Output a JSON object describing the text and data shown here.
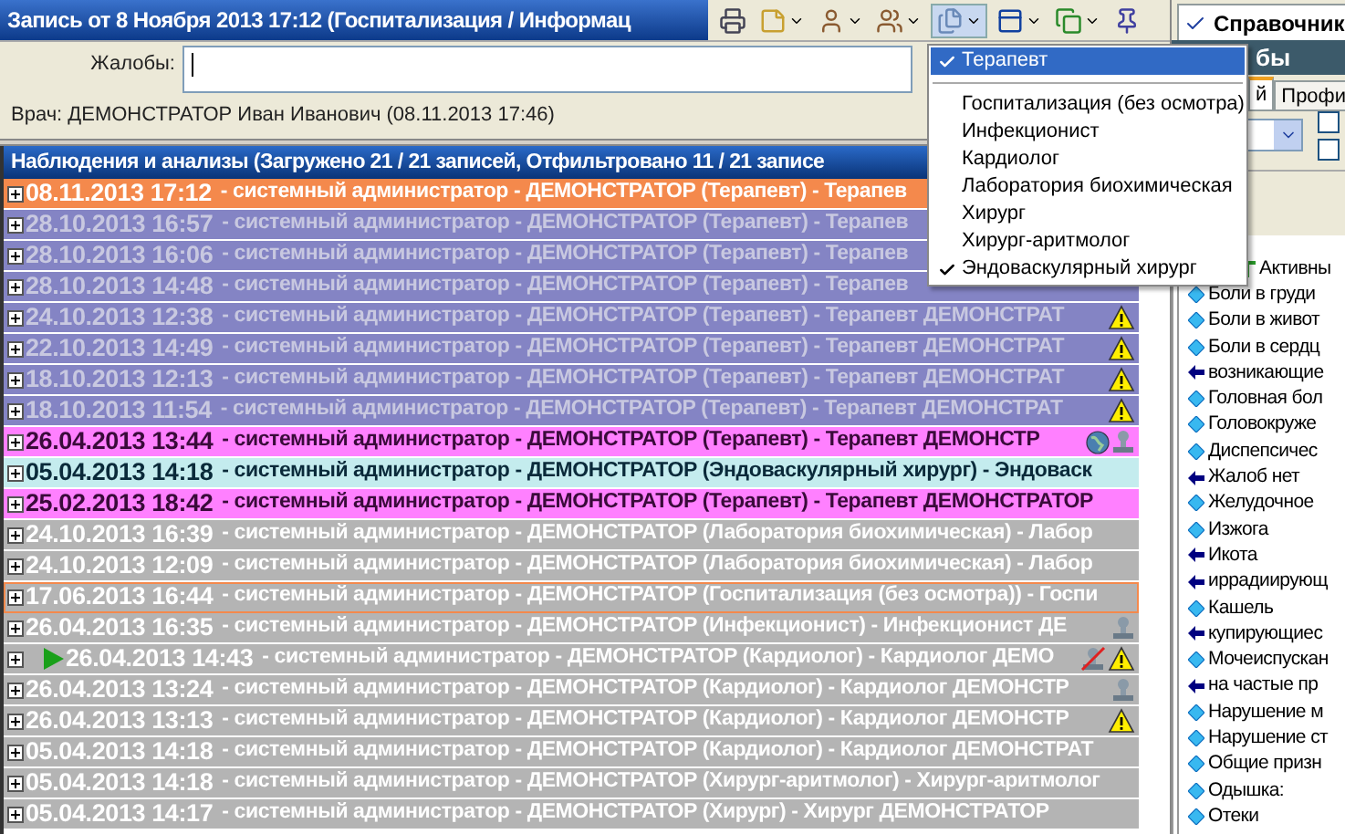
{
  "window": {
    "title": "Запись от 8 Ноября 2013 17:12 (Госпитализация / Информац"
  },
  "complaints": {
    "label": "Жалобы:"
  },
  "doctor_line": "Врач: ДЕМОНСТРАТОР Иван Иванович (08.11.2013 17:46)",
  "list": {
    "title": "Наблюдения и анализы (Загружено 21 / 21 записей, Отфильтровано 11 / 21 записе",
    "rows": [
      {
        "date": "08.11.2013 17:12",
        "text": "- системный администратор - ДЕМОНСТРАТОР (Терапевт) - Терапев",
        "kind": "orange",
        "selected": false,
        "current": false,
        "icons": []
      },
      {
        "date": "28.10.2013 16:57",
        "text": "- системный администратор - ДЕМОНСТРАТОР (Терапевт) - Терапев",
        "kind": "purple",
        "selected": false,
        "current": false,
        "icons": []
      },
      {
        "date": "28.10.2013 16:06",
        "text": "- системный администратор - ДЕМОНСТРАТОР (Терапевт) - Терапев",
        "kind": "purple",
        "selected": false,
        "current": false,
        "icons": []
      },
      {
        "date": "28.10.2013 14:48",
        "text": "- системный администратор - ДЕМОНСТРАТОР (Терапевт) - Терапев",
        "kind": "purple",
        "selected": false,
        "current": false,
        "icons": []
      },
      {
        "date": "24.10.2013 12:38",
        "text": "- системный администратор - ДЕМОНСТРАТОР (Терапевт) - Терапевт ДЕМОНСТРАТ",
        "kind": "purple",
        "selected": false,
        "current": false,
        "icons": [
          {
            "kind": "warning"
          }
        ]
      },
      {
        "date": "22.10.2013 14:49",
        "text": "- системный администратор - ДЕМОНСТРАТОР (Терапевт) - Терапевт ДЕМОНСТРАТ",
        "kind": "purple",
        "selected": false,
        "current": false,
        "icons": [
          {
            "kind": "warning"
          }
        ]
      },
      {
        "date": "18.10.2013 12:13",
        "text": "- системный администратор - ДЕМОНСТРАТОР (Терапевт) - Терапевт ДЕМОНСТРАТ",
        "kind": "purple",
        "selected": false,
        "current": false,
        "icons": [
          {
            "kind": "warning"
          }
        ]
      },
      {
        "date": "18.10.2013 11:54",
        "text": "- системный администратор - ДЕМОНСТРАТОР (Терапевт) - Терапевт ДЕМОНСТРАТ",
        "kind": "purple",
        "selected": false,
        "current": false,
        "icons": [
          {
            "kind": "warning"
          }
        ]
      },
      {
        "date": "26.04.2013 13:44",
        "text": "- системный администратор - ДЕМОНСТРАТОР (Терапевт) - Терапевт ДЕМОНСТР",
        "kind": "magenta",
        "selected": false,
        "current": false,
        "icons": [
          {
            "kind": "globe"
          },
          {
            "kind": "stamp"
          }
        ]
      },
      {
        "date": "05.04.2013 14:18",
        "text": "- системный администратор - ДЕМОНСТРАТОР (Эндоваскулярный хирург) - Эндоваск",
        "kind": "cyan",
        "selected": false,
        "current": false,
        "icons": []
      },
      {
        "date": "25.02.2013 18:42",
        "text": "- системный администратор - ДЕМОНСТРАТОР (Терапевт) - Терапевт ДЕМОНСТРАТОР",
        "kind": "magenta",
        "selected": false,
        "current": false,
        "icons": []
      },
      {
        "date": "24.10.2013 16:39",
        "text": "- системный администратор - ДЕМОНСТРАТОР (Лаборатория биохимическая) - Лабор",
        "kind": "grey",
        "selected": false,
        "current": false,
        "icons": []
      },
      {
        "date": "24.10.2013 12:09",
        "text": "- системный администратор - ДЕМОНСТРАТОР (Лаборатория биохимическая) - Лабор",
        "kind": "grey",
        "selected": false,
        "current": false,
        "icons": []
      },
      {
        "date": "17.06.2013 16:44",
        "text": "- системный администратор - ДЕМОНСТРАТОР (Госпитализация (без осмотра)) - Госпи",
        "kind": "grey",
        "selected": true,
        "current": false,
        "icons": []
      },
      {
        "date": "26.04.2013 16:35",
        "text": "- системный администратор - ДЕМОНСТРАТОР (Инфекционист) - Инфекционист ДЕ",
        "kind": "grey",
        "selected": false,
        "current": false,
        "icons": [
          {
            "kind": "stamp"
          }
        ]
      },
      {
        "date": "26.04.2013 14:43",
        "text": "- системный администратор - ДЕМОНСТРАТОР (Кардиолог) - Кардиолог ДЕМО",
        "kind": "grey",
        "selected": false,
        "current": true,
        "icons": [
          {
            "kind": "stamp-crossed"
          },
          {
            "kind": "warning"
          }
        ]
      },
      {
        "date": "26.04.2013 13:24",
        "text": "- системный администратор - ДЕМОНСТРАТОР (Кардиолог) - Кардиолог ДЕМОНСТР",
        "kind": "grey",
        "selected": false,
        "current": false,
        "icons": [
          {
            "kind": "stamp"
          }
        ]
      },
      {
        "date": "26.04.2013 13:13",
        "text": "- системный администратор - ДЕМОНСТРАТОР (Кардиолог) - Кардиолог ДЕМОНСТР",
        "kind": "grey",
        "selected": false,
        "current": false,
        "icons": [
          {
            "kind": "warning"
          }
        ]
      },
      {
        "date": "05.04.2013 14:18",
        "text": "- системный администратор - ДЕМОНСТРАТОР (Кардиолог) - Кардиолог ДЕМОНСТРАТ",
        "kind": "grey",
        "selected": false,
        "current": false,
        "icons": []
      },
      {
        "date": "05.04.2013 14:18",
        "text": "- системный администратор - ДЕМОНСТРАТОР (Хирург-аритмолог) - Хирург-аритмолог",
        "kind": "grey",
        "selected": false,
        "current": false,
        "icons": []
      },
      {
        "date": "05.04.2013 14:17",
        "text": "- системный администратор - ДЕМОНСТРАТОР (Хирург) - Хирург ДЕМОНСТРАТОР",
        "kind": "grey",
        "selected": false,
        "current": false,
        "icons": []
      }
    ]
  },
  "menu": {
    "items": [
      {
        "label": "Терапевт",
        "checked": true,
        "selected": true,
        "separator_after": true
      },
      {
        "label": "Госпитализация (без осмотра)",
        "checked": false,
        "selected": false,
        "separator_after": false
      },
      {
        "label": "Инфекционист",
        "checked": false,
        "selected": false,
        "separator_after": false
      },
      {
        "label": "Кардиолог",
        "checked": false,
        "selected": false,
        "separator_after": false
      },
      {
        "label": "Лаборатория биохимическая",
        "checked": false,
        "selected": false,
        "separator_after": false
      },
      {
        "label": "Хирург",
        "checked": false,
        "selected": false,
        "separator_after": false
      },
      {
        "label": "Хирург-аритмолог",
        "checked": false,
        "selected": false,
        "separator_after": false
      },
      {
        "label": "Эндоваскулярный хирург",
        "checked": true,
        "selected": false,
        "separator_after": false
      }
    ]
  },
  "side": {
    "tab": "Справочник",
    "header": "бы",
    "checkboxes": [
      {
        "checked": false
      },
      {
        "checked": false
      }
    ],
    "tabs": [
      {
        "label": "й",
        "selected": true
      },
      {
        "label": "Профи",
        "selected": false
      }
    ],
    "tree": [
      {
        "label": "Активны",
        "kind": "root"
      },
      {
        "label": "Боли в груди",
        "kind": "diamond"
      },
      {
        "label": "Боли в живот",
        "kind": "diamond"
      },
      {
        "label": "Боли в сердц",
        "kind": "diamond"
      },
      {
        "label": "возникающие",
        "kind": "arrow"
      },
      {
        "label": "Головная бол",
        "kind": "diamond"
      },
      {
        "label": "Головокруже",
        "kind": "diamond"
      },
      {
        "label": "Диспепсичес",
        "kind": "diamond"
      },
      {
        "label": "Жалоб нет",
        "kind": "arrow"
      },
      {
        "label": "Желудочное",
        "kind": "diamond"
      },
      {
        "label": "Изжога",
        "kind": "diamond"
      },
      {
        "label": "Икота",
        "kind": "arrow"
      },
      {
        "label": "иррадиирующ",
        "kind": "arrow"
      },
      {
        "label": "Кашель",
        "kind": "diamond"
      },
      {
        "label": "купирующиес",
        "kind": "arrow"
      },
      {
        "label": "Мочеиспускан",
        "kind": "diamond"
      },
      {
        "label": "на частые пр",
        "kind": "arrow"
      },
      {
        "label": "Нарушение м",
        "kind": "diamond"
      },
      {
        "label": "Нарушение ст",
        "kind": "diamond"
      },
      {
        "label": "Общие призн",
        "kind": "diamond"
      },
      {
        "label": "Одышка:",
        "kind": "diamond"
      },
      {
        "label": "Отеки",
        "kind": "diamond"
      }
    ]
  }
}
